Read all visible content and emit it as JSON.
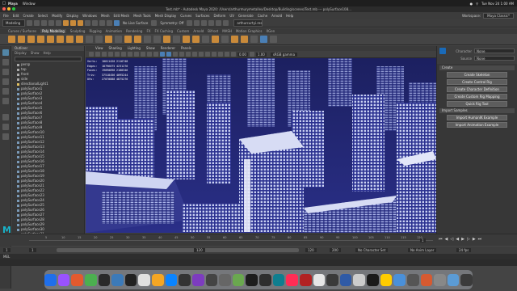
{
  "macos_menubar": {
    "app": "Maya",
    "menu": "Window",
    "datetime": "Tue Nov 24  1:00 AM"
  },
  "window": {
    "title": "Test.mb* - Autodesk Maya 2020: /Users/arthurmurymetallex/Desktop/Building/scenes/Test.mb  ---  polySurface108..."
  },
  "maya_menu": [
    "File",
    "Edit",
    "Create",
    "Select",
    "Modify",
    "Display",
    "Windows",
    "Mesh",
    "Edit Mesh",
    "Mesh Tools",
    "Mesh Display",
    "Curves",
    "Surfaces",
    "Deform",
    "UV",
    "Generate",
    "Cache",
    "Arnold",
    "Help"
  ],
  "workspace": {
    "label": "Workspace:",
    "value": "Maya Classic*"
  },
  "status_line": {
    "mode": "Modeling",
    "live_surface": "No Live Surface",
    "symmetry": "Symmetry: Off",
    "render_name": "arthurcurtyi.res"
  },
  "shelf_tabs": [
    "Curves / Surfaces",
    "Poly Modeling",
    "Sculpting",
    "Rigging",
    "Animation",
    "Rendering",
    "FX",
    "FX Caching",
    "Custom",
    "Arnold",
    "Bifrost",
    "MASH",
    "Motion Graphics",
    "XGen"
  ],
  "shelf_active": "Poly Modeling",
  "outliner": {
    "title": "Outliner",
    "menu": [
      "Display",
      "Show",
      "Help"
    ],
    "items": [
      {
        "name": "persp",
        "type": "cam"
      },
      {
        "name": "top",
        "type": "cam"
      },
      {
        "name": "front",
        "type": "cam"
      },
      {
        "name": "side",
        "type": "cam"
      },
      {
        "name": "directionalLight1",
        "type": "light"
      },
      {
        "name": "polySurface1",
        "type": "mesh"
      },
      {
        "name": "polySurface2",
        "type": "mesh"
      },
      {
        "name": "polySurface3",
        "type": "mesh"
      },
      {
        "name": "polySurface4",
        "type": "mesh"
      },
      {
        "name": "polySurface5",
        "type": "mesh"
      },
      {
        "name": "polySurface6",
        "type": "mesh"
      },
      {
        "name": "polySurface7",
        "type": "mesh"
      },
      {
        "name": "polySurface8",
        "type": "mesh"
      },
      {
        "name": "polySurface9",
        "type": "mesh"
      },
      {
        "name": "polySurface10",
        "type": "mesh"
      },
      {
        "name": "polySurface11",
        "type": "mesh"
      },
      {
        "name": "polySurface12",
        "type": "mesh"
      },
      {
        "name": "polySurface13",
        "type": "mesh"
      },
      {
        "name": "polySurface14",
        "type": "mesh"
      },
      {
        "name": "polySurface15",
        "type": "mesh"
      },
      {
        "name": "polySurface16",
        "type": "mesh"
      },
      {
        "name": "polySurface17",
        "type": "mesh"
      },
      {
        "name": "polySurface18",
        "type": "mesh"
      },
      {
        "name": "polySurface19",
        "type": "mesh"
      },
      {
        "name": "polySurface20",
        "type": "mesh"
      },
      {
        "name": "polySurface21",
        "type": "mesh"
      },
      {
        "name": "polySurface22",
        "type": "mesh"
      },
      {
        "name": "polySurface23",
        "type": "mesh"
      },
      {
        "name": "polySurface24",
        "type": "mesh"
      },
      {
        "name": "polySurface25",
        "type": "mesh"
      },
      {
        "name": "polySurface26",
        "type": "mesh"
      },
      {
        "name": "polySurface27",
        "type": "mesh"
      },
      {
        "name": "polySurface28",
        "type": "mesh"
      },
      {
        "name": "polySurface29",
        "type": "mesh"
      },
      {
        "name": "polySurface30",
        "type": "mesh"
      },
      {
        "name": "polySurface31",
        "type": "mesh"
      }
    ]
  },
  "viewport": {
    "menu": [
      "View",
      "Shading",
      "Lighting",
      "Show",
      "Renderer",
      "Panels"
    ],
    "field_a": "0.00",
    "field_b": "1.00",
    "color_space": "sRGB gamma",
    "hud": [
      [
        "Verts:",
        "10011420",
        "2116748"
      ],
      [
        "Edges:",
        "18796075",
        "4231276"
      ],
      [
        "Faces:",
        "19090898",
        "2188346"
      ],
      [
        "Tris:",
        "37518456",
        "4095244"
      ],
      [
        "UVs:",
        "27070888",
        "4875276"
      ]
    ],
    "camera_label": "persp"
  },
  "character_panel": {
    "character_label": "Character",
    "character_value": "None",
    "source_label": "Source",
    "source_value": "None",
    "create_section": "Create",
    "buttons": [
      "Create Skeleton",
      "Create Control Rig",
      "Create Character Definition",
      "Create Custom Rig Mapping",
      "Quick Rig Tool"
    ],
    "import_section": "Import Samples",
    "import_buttons": [
      "Import HumanIK Example",
      "Import Animation Example"
    ]
  },
  "timeline": {
    "ticks": [
      "5",
      "10",
      "15",
      "20",
      "25",
      "30",
      "35",
      "40",
      "45",
      "50",
      "55",
      "60",
      "65",
      "70",
      "75",
      "80",
      "85",
      "90",
      "95",
      "100",
      "105",
      "110",
      "115",
      "120"
    ],
    "current_frame": "1"
  },
  "range": {
    "start": "1",
    "start_inner": "1",
    "end_inner": "120",
    "end": "120",
    "end_outer": "200",
    "character_set": "No Character Set",
    "anim_layer": "No Anim Layer",
    "fps": "24 fps"
  },
  "command_line": {
    "label": "MEL"
  },
  "dock_colors": [
    "#1f6feb",
    "#9a52ff",
    "#e35a2f",
    "#4caf50",
    "#2a2a2a",
    "#3c7ab8",
    "#222",
    "#e0e0e0",
    "#f5a623",
    "#0a84ff",
    "#333",
    "#7d3cbf",
    "#444",
    "#666",
    "#6aa84f",
    "#1d1d1d",
    "#2e2e2e",
    "#0f7e8f",
    "#ff2d55",
    "#b22222",
    "#e6e6e6",
    "#3a3a3a",
    "#2f5aa6",
    "#cccccc",
    "#1a1a1a",
    "#ffcc00",
    "#4a90d9",
    "#555555",
    "#d65a31",
    "#888888",
    "#5b9bd5",
    "#3b3b3b"
  ]
}
